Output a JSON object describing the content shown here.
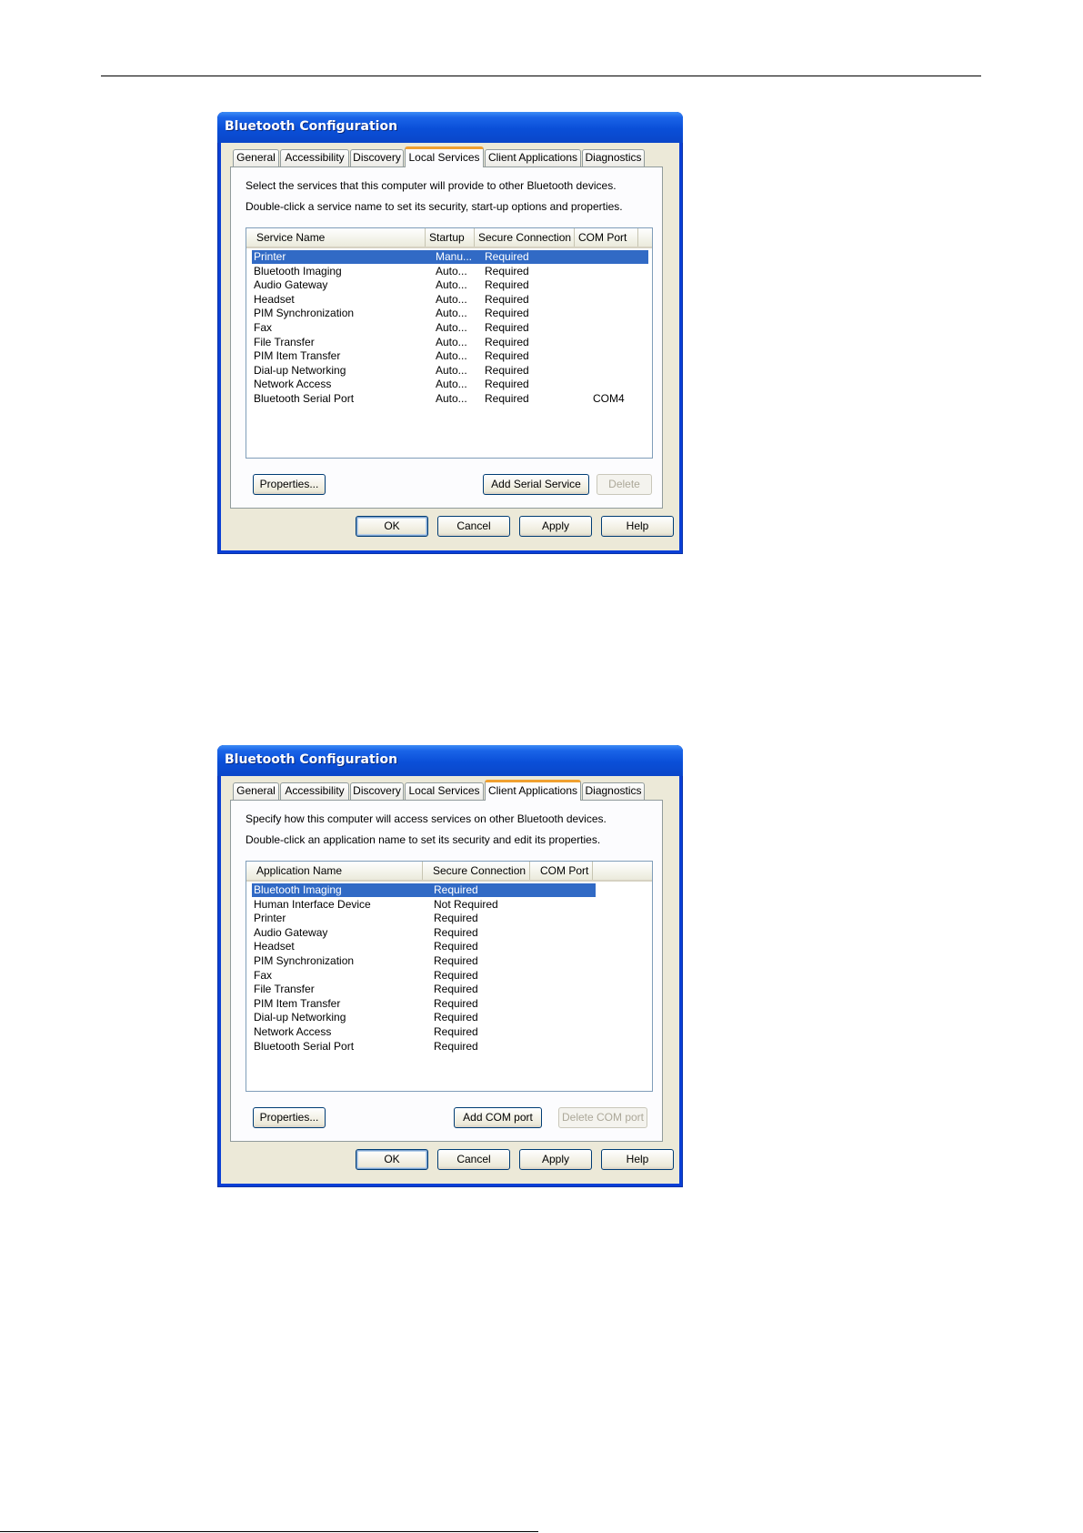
{
  "windows": [
    {
      "title": "Bluetooth Configuration",
      "tabs": [
        "General",
        "Accessibility",
        "Discovery",
        "Local Services",
        "Client Applications",
        "Diagnostics"
      ],
      "active_tab": "Local Services",
      "instructions": [
        "Select the services that this computer will provide to other Bluetooth devices.",
        "Double-click a service name to set its security, start-up options and properties."
      ],
      "columns": [
        "Service Name",
        "Startup",
        "Secure Connection",
        "COM Port"
      ],
      "rows": [
        [
          "Printer",
          "Manu...",
          "Required",
          ""
        ],
        [
          "Bluetooth Imaging",
          "Auto...",
          "Required",
          ""
        ],
        [
          "Audio Gateway",
          "Auto...",
          "Required",
          ""
        ],
        [
          "Headset",
          "Auto...",
          "Required",
          ""
        ],
        [
          "PIM Synchronization",
          "Auto...",
          "Required",
          ""
        ],
        [
          "Fax",
          "Auto...",
          "Required",
          ""
        ],
        [
          "File Transfer",
          "Auto...",
          "Required",
          ""
        ],
        [
          "PIM Item Transfer",
          "Auto...",
          "Required",
          ""
        ],
        [
          "Dial-up Networking",
          "Auto...",
          "Required",
          ""
        ],
        [
          "Network Access",
          "Auto...",
          "Required",
          ""
        ],
        [
          "Bluetooth Serial Port",
          "Auto...",
          "Required",
          "COM4"
        ]
      ],
      "selected_row": "Printer",
      "buttons": {
        "properties": "Properties...",
        "add": "Add Serial Service",
        "delete": "Delete",
        "ok": "OK",
        "cancel": "Cancel",
        "apply": "Apply",
        "help": "Help"
      }
    },
    {
      "title": "Bluetooth Configuration",
      "tabs": [
        "General",
        "Accessibility",
        "Discovery",
        "Local Services",
        "Client Applications",
        "Diagnostics"
      ],
      "active_tab": "Client Applications",
      "instructions": [
        "Specify how this computer will access services on other Bluetooth devices.",
        "Double-click an application name to set its security and edit its properties."
      ],
      "columns": [
        "Application Name",
        "Secure Connection",
        "COM Port"
      ],
      "rows": [
        [
          "Bluetooth Imaging",
          "Required",
          ""
        ],
        [
          "Human Interface Device",
          "Not Required",
          ""
        ],
        [
          "Printer",
          "Required",
          ""
        ],
        [
          "Audio Gateway",
          "Required",
          ""
        ],
        [
          "Headset",
          "Required",
          ""
        ],
        [
          "PIM Synchronization",
          "Required",
          ""
        ],
        [
          "Fax",
          "Required",
          ""
        ],
        [
          "File Transfer",
          "Required",
          ""
        ],
        [
          "PIM Item Transfer",
          "Required",
          ""
        ],
        [
          "Dial-up Networking",
          "Required",
          ""
        ],
        [
          "Network Access",
          "Required",
          ""
        ],
        [
          "Bluetooth Serial Port",
          "Required",
          ""
        ]
      ],
      "selected_row": "Bluetooth Imaging",
      "buttons": {
        "properties": "Properties...",
        "add": "Add COM port",
        "delete": "Delete COM port",
        "ok": "OK",
        "cancel": "Cancel",
        "apply": "Apply",
        "help": "Help"
      }
    }
  ],
  "colors": {
    "titlebar": "#0a4fd8",
    "selection": "#316ac5",
    "active_tab_accent": "#f0a030",
    "dialog_face": "#ece9d8"
  }
}
